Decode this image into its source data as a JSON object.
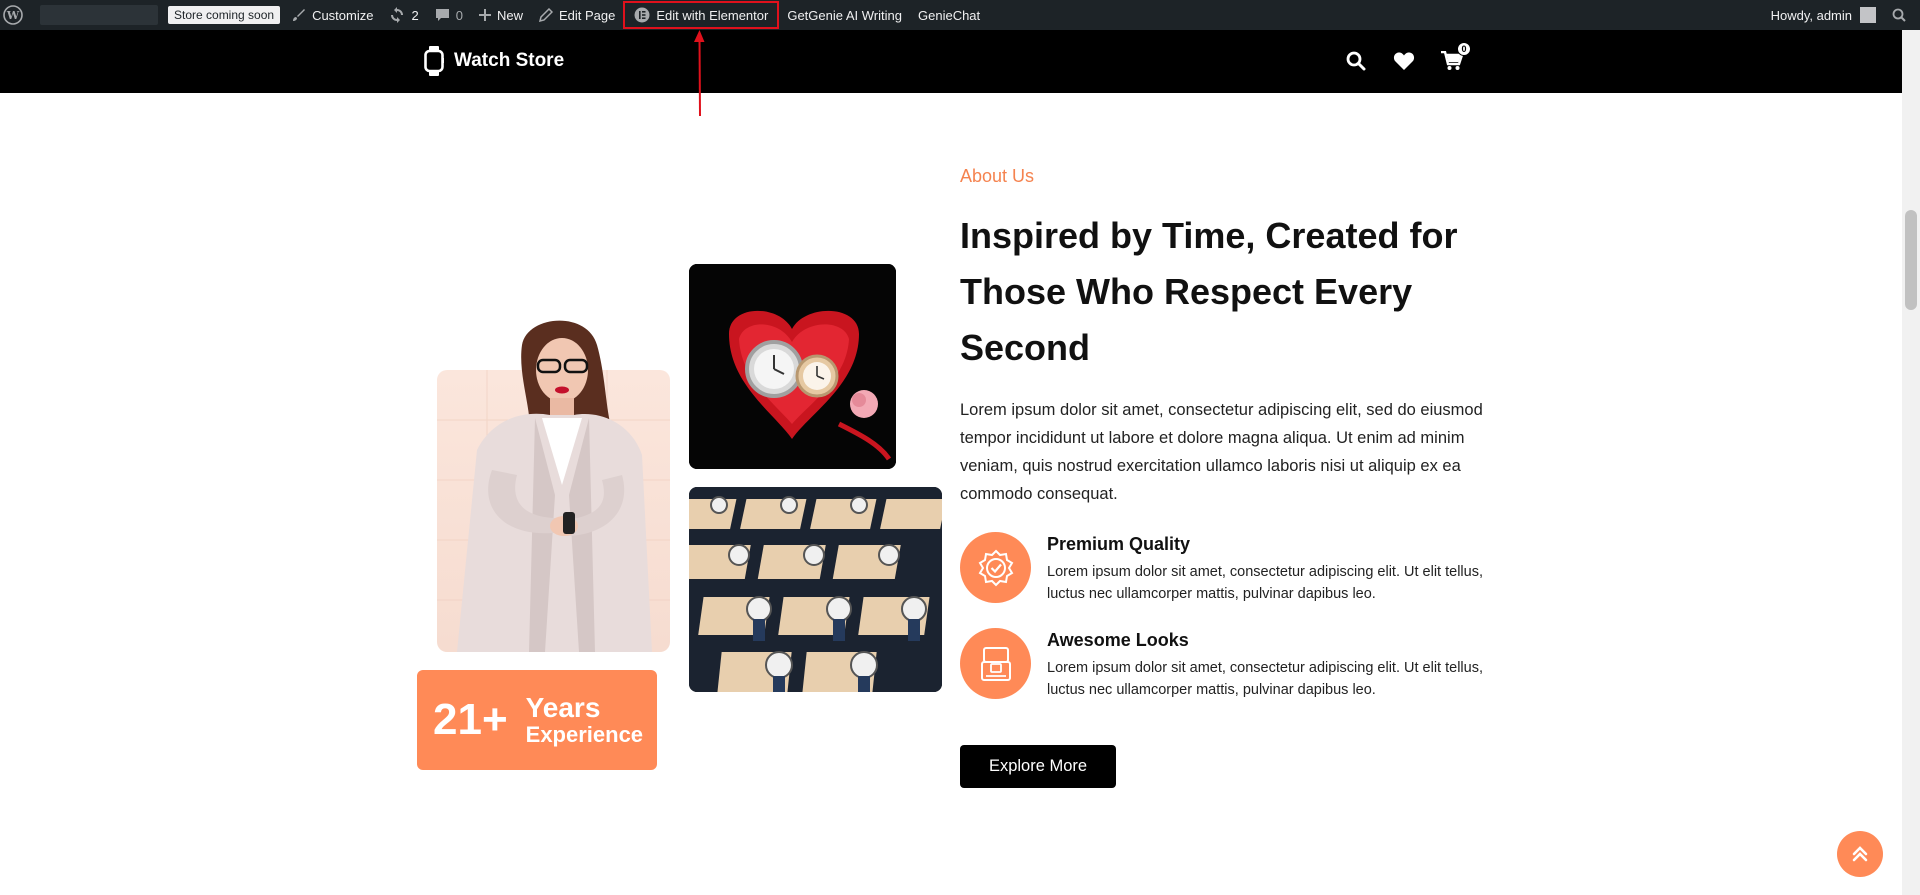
{
  "adminbar": {
    "store_status": "Store coming soon",
    "customize": "Customize",
    "updates_count": "2",
    "comments_count": "0",
    "new": "New",
    "edit_page": "Edit Page",
    "edit_elementor": "Edit with Elementor",
    "getgenie": "GetGenie AI Writing",
    "geniechat": "GenieChat",
    "howdy": "Howdy, admin"
  },
  "header": {
    "brand": "Watch Store",
    "cart_count": "0"
  },
  "about": {
    "label": "About Us",
    "heading": "Inspired by Time, Created for Those Who Respect Every Second",
    "paragraph": "Lorem ipsum dolor sit amet, consectetur adipiscing elit, sed do eiusmod tempor incididunt ut labore et dolore magna aliqua. Ut enim ad minim veniam, quis nostrud exercitation ullamco laboris nisi ut aliquip ex ea commodo consequat.",
    "features": [
      {
        "title": "Premium Quality",
        "desc": "Lorem ipsum dolor sit amet, consectetur adipiscing elit. Ut elit tellus, luctus nec ullamcorper mattis, pulvinar dapibus leo."
      },
      {
        "title": "Awesome Looks",
        "desc": "Lorem ipsum dolor sit amet, consectetur adipiscing elit. Ut elit tellus, luctus nec ullamcorper mattis, pulvinar dapibus leo."
      }
    ],
    "button": "Explore More"
  },
  "experience": {
    "number": "21+",
    "years": "Years",
    "label": "Experience"
  },
  "colors": {
    "accent": "#ff8a57",
    "about_label": "#f5834f",
    "annotation": "#e0111c"
  }
}
